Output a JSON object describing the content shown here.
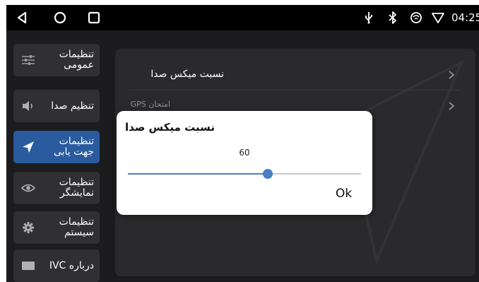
{
  "status_bar": {
    "time": "04:25"
  },
  "sidebar": {
    "items": [
      {
        "label": "تنظيمات\nعمومی",
        "icon": "sliders-icon"
      },
      {
        "label": "تنظیم صدا",
        "icon": "speaker-icon"
      },
      {
        "label": "تنظیمات\nجهت یابی",
        "icon": "navigation-arrow-icon",
        "active": true
      },
      {
        "label": "تنظیمات\nنمایشگر",
        "icon": "eye-icon"
      },
      {
        "label": "تنظیمات\nسیستم",
        "icon": "gear-icon"
      },
      {
        "label": "درباره IVC",
        "icon": "card-icon"
      }
    ]
  },
  "panel": {
    "rows": [
      {
        "label": "نسبت میکس صدا"
      },
      {
        "label": "امتحان GPS"
      }
    ]
  },
  "dialog": {
    "title": "نسبت میکس صدا",
    "value": "60",
    "slider_fraction": 0.6,
    "ok_label": "Ok"
  },
  "colors": {
    "accent": "#4a7fc1",
    "active_sidebar": "#2a5b9e",
    "sidebar_item": "#303033",
    "panel": "#2a2a2c"
  }
}
